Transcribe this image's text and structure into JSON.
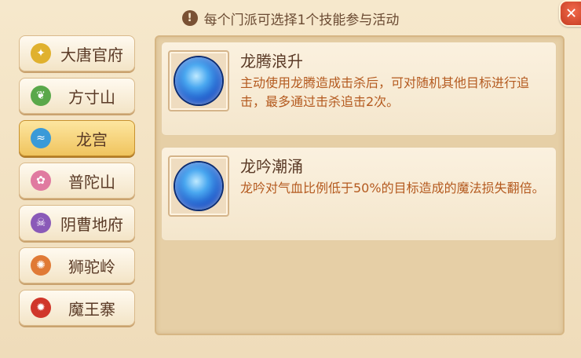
{
  "notice": {
    "icon": "exclamation-icon",
    "text": "每个门派可选择1个技能参与活动"
  },
  "close": {
    "icon": "close-icon"
  },
  "schools": [
    {
      "label": "大唐官府",
      "icon": "sword-emblem-icon",
      "color": "#e0b12e",
      "active": false
    },
    {
      "label": "方寸山",
      "icon": "leaf-emblem-icon",
      "color": "#5aa84a",
      "active": false
    },
    {
      "label": "龙宫",
      "icon": "wave-emblem-icon",
      "color": "#3a9ad8",
      "active": true
    },
    {
      "label": "普陀山",
      "icon": "lotus-emblem-icon",
      "color": "#e07aa0",
      "active": false
    },
    {
      "label": "阴曹地府",
      "icon": "skull-emblem-icon",
      "color": "#8a5ab8",
      "active": false
    },
    {
      "label": "狮驼岭",
      "icon": "lion-emblem-icon",
      "color": "#e07a36",
      "active": false
    },
    {
      "label": "魔王寨",
      "icon": "demon-emblem-icon",
      "color": "#d0362a",
      "active": false
    }
  ],
  "skills": [
    {
      "name": "龙腾浪升",
      "icon": "dragon-wave-skill-icon",
      "desc": "主动使用龙腾造成击杀后，可对随机其他目标进行追击，最多通过击杀追击2次。"
    },
    {
      "name": "龙吟潮涌",
      "icon": "dragon-roar-skill-icon",
      "desc": "龙吟对气血比例低于50%的目标造成的魔法损失翻倍。"
    }
  ]
}
